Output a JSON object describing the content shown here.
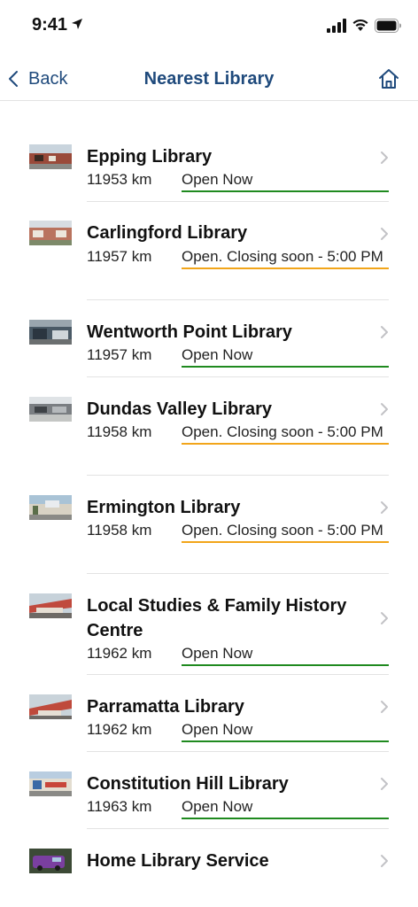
{
  "status_bar": {
    "time": "9:41"
  },
  "nav": {
    "back_label": "Back",
    "title": "Nearest Library"
  },
  "colors": {
    "accent": "#1f4a7c",
    "open": "#1f8a1f",
    "closing": "#f2a51a"
  },
  "libraries": [
    {
      "name": "Epping Library",
      "distance": "11953 km",
      "status": "Open Now",
      "status_type": "open"
    },
    {
      "name": "Carlingford Library",
      "distance": "11957 km",
      "status": "Open. Closing soon - 5:00 PM",
      "status_type": "closing"
    },
    {
      "name": "Wentworth Point Library",
      "distance": "11957 km",
      "status": "Open Now",
      "status_type": "open"
    },
    {
      "name": "Dundas Valley Library",
      "distance": "11958 km",
      "status": "Open. Closing soon - 5:00 PM",
      "status_type": "closing"
    },
    {
      "name": "Ermington Library",
      "distance": "11958 km",
      "status": "Open. Closing soon - 5:00 PM",
      "status_type": "closing"
    },
    {
      "name": "Local Studies & Family History Centre",
      "distance": "11962 km",
      "status": "Open Now",
      "status_type": "open"
    },
    {
      "name": "Parramatta Library",
      "distance": "11962 km",
      "status": "Open Now",
      "status_type": "open"
    },
    {
      "name": "Constitution Hill Library",
      "distance": "11963 km",
      "status": "Open Now",
      "status_type": "open"
    },
    {
      "name": "Home Library Service",
      "distance": "",
      "status": "",
      "status_type": "none"
    }
  ]
}
